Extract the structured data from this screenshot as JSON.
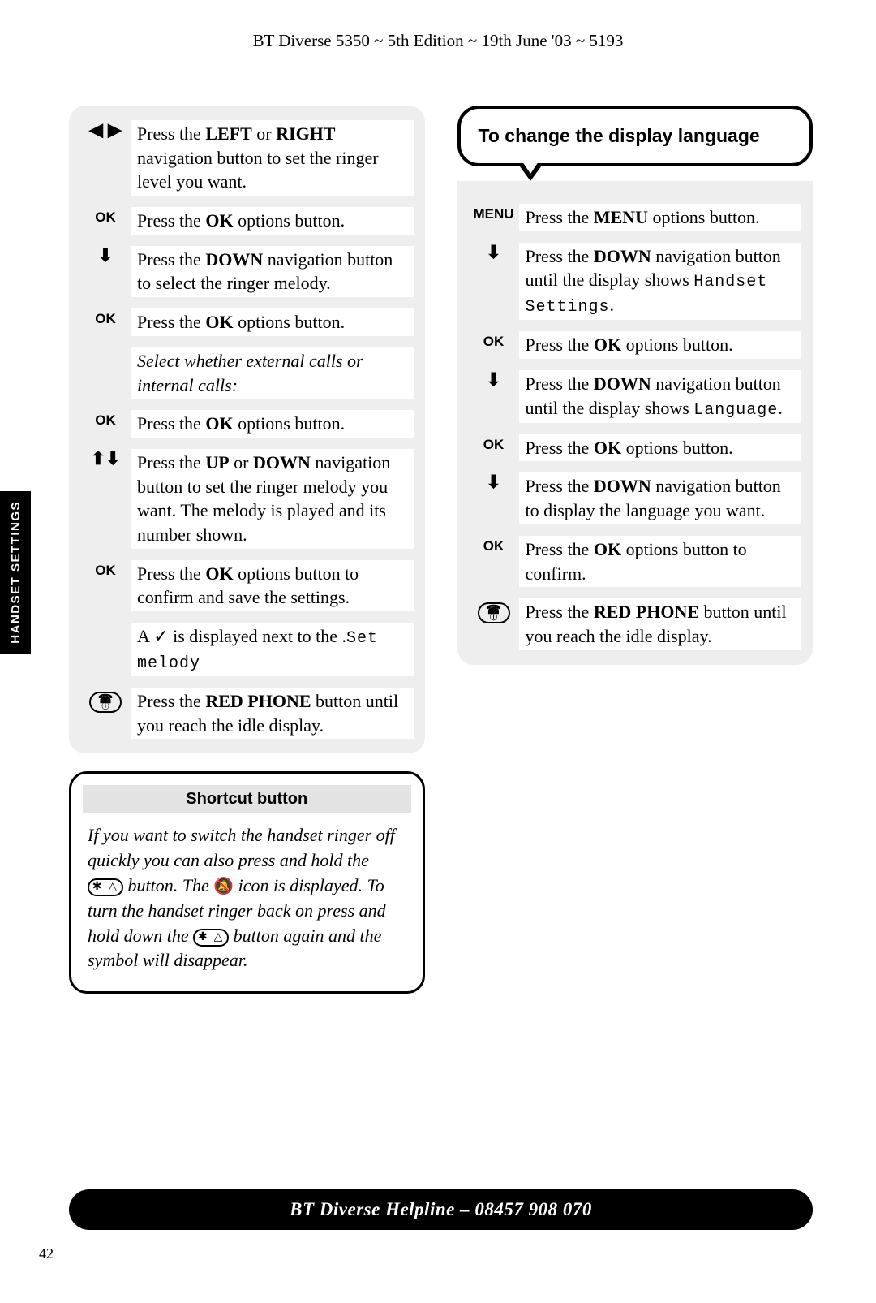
{
  "header": "BT Diverse 5350 ~ 5th Edition ~ 19th June '03 ~ 5193",
  "side_tab": "HANDSET SETTINGS",
  "left": {
    "steps": [
      {
        "key_glyph": "◀ ▶",
        "text_pre": "Press the ",
        "bold1": "LEFT",
        "mid1": " or ",
        "bold2": "RIGHT",
        "text_post": " navigation button to set the ringer level you want."
      },
      {
        "key_text": "OK",
        "text_pre": "Press the ",
        "bold1": "OK",
        "text_post": " options button."
      },
      {
        "key_glyph": "⬇",
        "text_pre": "Press the ",
        "bold1": "DOWN",
        "text_post": " navigation button to select the ringer melody."
      },
      {
        "key_text": "OK",
        "text_pre": "Press the ",
        "bold1": "OK",
        "text_post": " options button."
      },
      {
        "blank_key": true,
        "italic_text": "Select whether external calls or internal calls:"
      },
      {
        "key_text": "OK",
        "text_pre": "Press the ",
        "bold1": "OK",
        "text_post": " options button."
      },
      {
        "key_glyph": "⬆⬇",
        "text_pre": "Press the ",
        "bold1": "UP",
        "mid1": " or ",
        "bold2": "DOWN",
        "text_post": " navigation button to set the ringer melody you want. The melody is played and its number shown."
      },
      {
        "key_text": "OK",
        "text_pre": "Press the ",
        "bold1": "OK",
        "text_post": " options button to confirm and save the settings."
      },
      {
        "blank_key": true,
        "text_pre": "A ",
        "check": "✓",
        "mid1": " is displayed next to the ",
        "mono": "Set melody",
        "text_post": "."
      },
      {
        "phone_key": true,
        "text_pre": "Press the ",
        "bold1": "RED PHONE",
        "text_post": " button until you reach the idle display."
      }
    ]
  },
  "shortcut": {
    "title": "Shortcut button",
    "p1": "If you want to switch the handset ringer off quickly you can also press and hold the ",
    "star": "✱ △",
    "p2": " button. The ",
    "bell": "🔕",
    "p3": " icon is displayed. To turn the handset ringer back on press and hold down the ",
    "p4": " button again and the symbol will disappear."
  },
  "right": {
    "callout": "To change the display language",
    "steps": [
      {
        "key_text": "MENU",
        "text_pre": "Press the ",
        "bold1": "MENU",
        "text_post": " options button."
      },
      {
        "key_glyph": "⬇",
        "text_pre": "Press the ",
        "bold1": "DOWN",
        "text_post": " navigation button until the display shows ",
        "mono": "Handset Settings",
        "tail": "."
      },
      {
        "key_text": "OK",
        "text_pre": "Press the ",
        "bold1": "OK",
        "text_post": " options button."
      },
      {
        "key_glyph": "⬇",
        "text_pre": "Press the ",
        "bold1": "DOWN",
        "text_post": " navigation button until the display shows ",
        "mono": "Language",
        "tail": "."
      },
      {
        "key_text": "OK",
        "text_pre": "Press the ",
        "bold1": "OK",
        "text_post": " options button."
      },
      {
        "key_glyph": "⬇",
        "text_pre": "Press the ",
        "bold1": "DOWN",
        "text_post": " navigation button to display the language you want."
      },
      {
        "key_text": "OK",
        "text_pre": "Press the ",
        "bold1": "OK",
        "text_post": " options button to confirm."
      },
      {
        "phone_key": true,
        "text_pre": "Press the ",
        "bold1": "RED PHONE",
        "text_post": " button until you reach the idle display."
      }
    ]
  },
  "helpline": "BT Diverse Helpline – 08457 908 070",
  "page_num": "42"
}
